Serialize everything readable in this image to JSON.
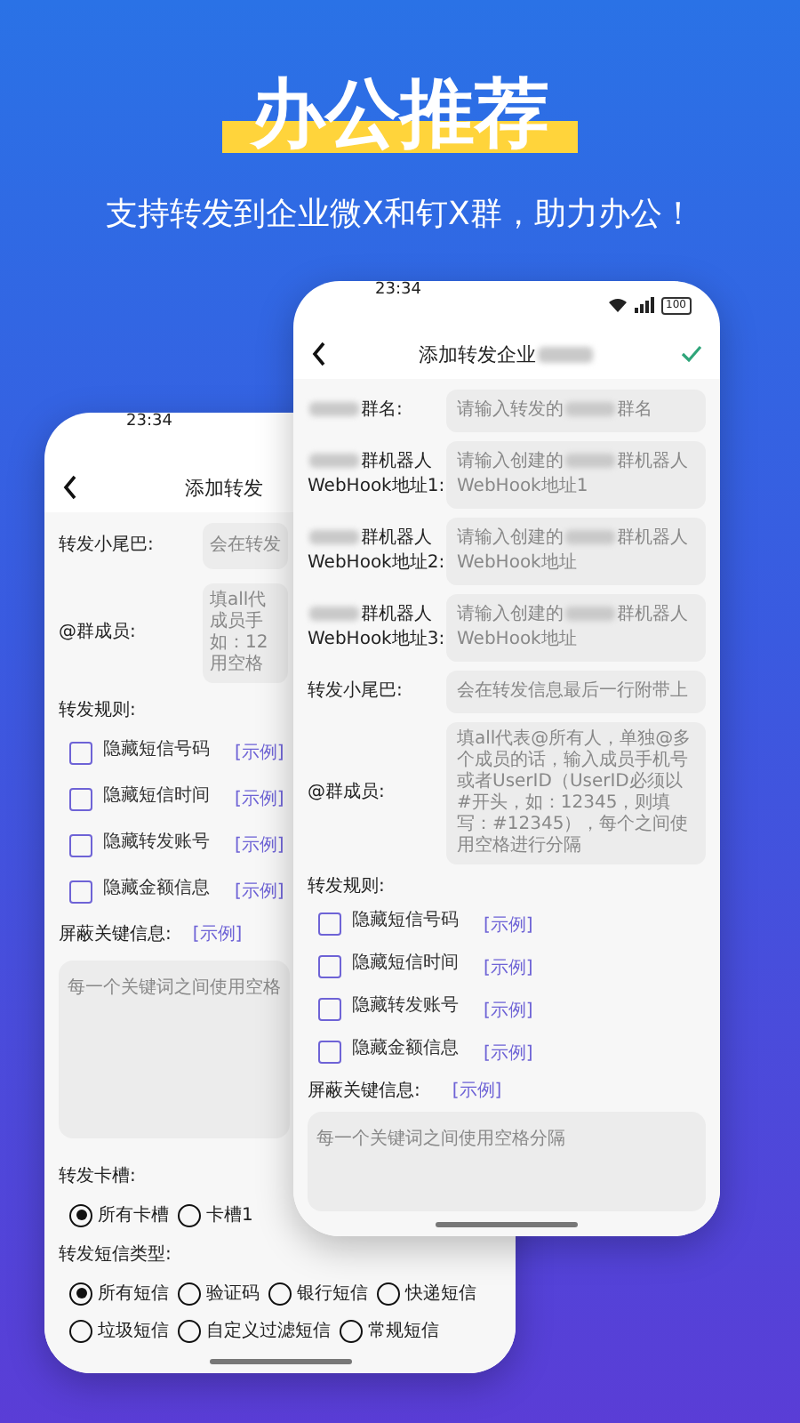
{
  "headline": "办公推荐",
  "subtitle": "支持转发到企业微X和钉X群，助力办公！",
  "back_phone": {
    "time": "23:34",
    "title": "添加转发",
    "tail": {
      "label": "转发小尾巴:",
      "placeholder": "会在转发"
    },
    "members": {
      "label": "@群成员:",
      "hint_lines": [
        "填all代",
        "成员手",
        "如：12",
        "用空格"
      ]
    },
    "rules_label": "转发规则:",
    "rules": [
      {
        "label": "隐藏短信号码",
        "link": "[示例]",
        "checked": false
      },
      {
        "label": "隐藏短信时间",
        "link": "[示例]",
        "checked": false
      },
      {
        "label": "隐藏转发账号",
        "link": "[示例]",
        "checked": false
      },
      {
        "label": "隐藏金额信息",
        "link": "[示例]",
        "checked": false
      }
    ],
    "keywords": {
      "label": "屏蔽关键信息:",
      "link": "[示例]",
      "placeholder": "每一个关键词之间使用空格"
    },
    "sim": {
      "label": "转发卡槽:",
      "options": [
        {
          "label": "所有卡槽",
          "selected": true
        },
        {
          "label": "卡槽1",
          "selected": false
        }
      ]
    },
    "sms_type": {
      "label": "转发短信类型:",
      "options": [
        {
          "label": "所有短信",
          "selected": true
        },
        {
          "label": "验证码",
          "selected": false
        },
        {
          "label": "银行短信",
          "selected": false
        },
        {
          "label": "快递短信",
          "selected": false
        },
        {
          "label": "垃圾短信",
          "selected": false
        },
        {
          "label": "自定义过滤短信",
          "selected": false
        },
        {
          "label": "常规短信",
          "selected": false
        }
      ]
    }
  },
  "front_phone": {
    "time": "23:34",
    "battery": "100",
    "title": [
      {
        "kind": "text",
        "text": "添加转发企业"
      },
      {
        "kind": "blur"
      }
    ],
    "fields": [
      {
        "label": [
          [
            {
              "kind": "blur"
            },
            {
              "kind": "text",
              "text": "群名:"
            }
          ]
        ],
        "placeholder": [
          [
            {
              "kind": "text",
              "text": "请输入转发的"
            },
            {
              "kind": "blur"
            },
            {
              "kind": "text",
              "text": "群名"
            }
          ]
        ]
      },
      {
        "label": [
          [
            {
              "kind": "blur"
            },
            {
              "kind": "text",
              "text": "群机器人"
            }
          ],
          [
            {
              "kind": "text",
              "text": "WebHook地址1:"
            }
          ]
        ],
        "placeholder": [
          [
            {
              "kind": "text",
              "text": "请输入创建的"
            },
            {
              "kind": "blur"
            },
            {
              "kind": "text",
              "text": "群机器人"
            }
          ],
          [
            {
              "kind": "text",
              "text": "WebHook地址1"
            }
          ]
        ]
      },
      {
        "label": [
          [
            {
              "kind": "blur"
            },
            {
              "kind": "text",
              "text": "群机器人"
            }
          ],
          [
            {
              "kind": "text",
              "text": "WebHook地址2:"
            }
          ]
        ],
        "placeholder": [
          [
            {
              "kind": "text",
              "text": "请输入创建的"
            },
            {
              "kind": "blur"
            },
            {
              "kind": "text",
              "text": "群机器人"
            }
          ],
          [
            {
              "kind": "text",
              "text": "WebHook地址"
            }
          ]
        ]
      },
      {
        "label": [
          [
            {
              "kind": "blur"
            },
            {
              "kind": "text",
              "text": "群机器人"
            }
          ],
          [
            {
              "kind": "text",
              "text": "WebHook地址3:"
            }
          ]
        ],
        "placeholder": [
          [
            {
              "kind": "text",
              "text": "请输入创建的"
            },
            {
              "kind": "blur"
            },
            {
              "kind": "text",
              "text": "群机器人"
            }
          ],
          [
            {
              "kind": "text",
              "text": "WebHook地址"
            }
          ]
        ]
      }
    ],
    "tail": {
      "label": "转发小尾巴:",
      "placeholder": "会在转发信息最后一行附带上"
    },
    "members": {
      "label": "@群成员:",
      "hint": "填all代表@所有人，单独@多个成员的话，输入成员手机号或者UserID（UserID必须以#开头，如：12345，则填写：#12345），每个之间使用空格进行分隔"
    },
    "rules_label": "转发规则:",
    "rules": [
      {
        "label": "隐藏短信号码",
        "link": "[示例]",
        "checked": false
      },
      {
        "label": "隐藏短信时间",
        "link": "[示例]",
        "checked": false
      },
      {
        "label": "隐藏转发账号",
        "link": "[示例]",
        "checked": false
      },
      {
        "label": "隐藏金额信息",
        "link": "[示例]",
        "checked": false
      }
    ],
    "keywords": {
      "label": "屏蔽关键信息:",
      "link": "[示例]",
      "placeholder": "每一个关键词之间使用空格分隔"
    }
  }
}
